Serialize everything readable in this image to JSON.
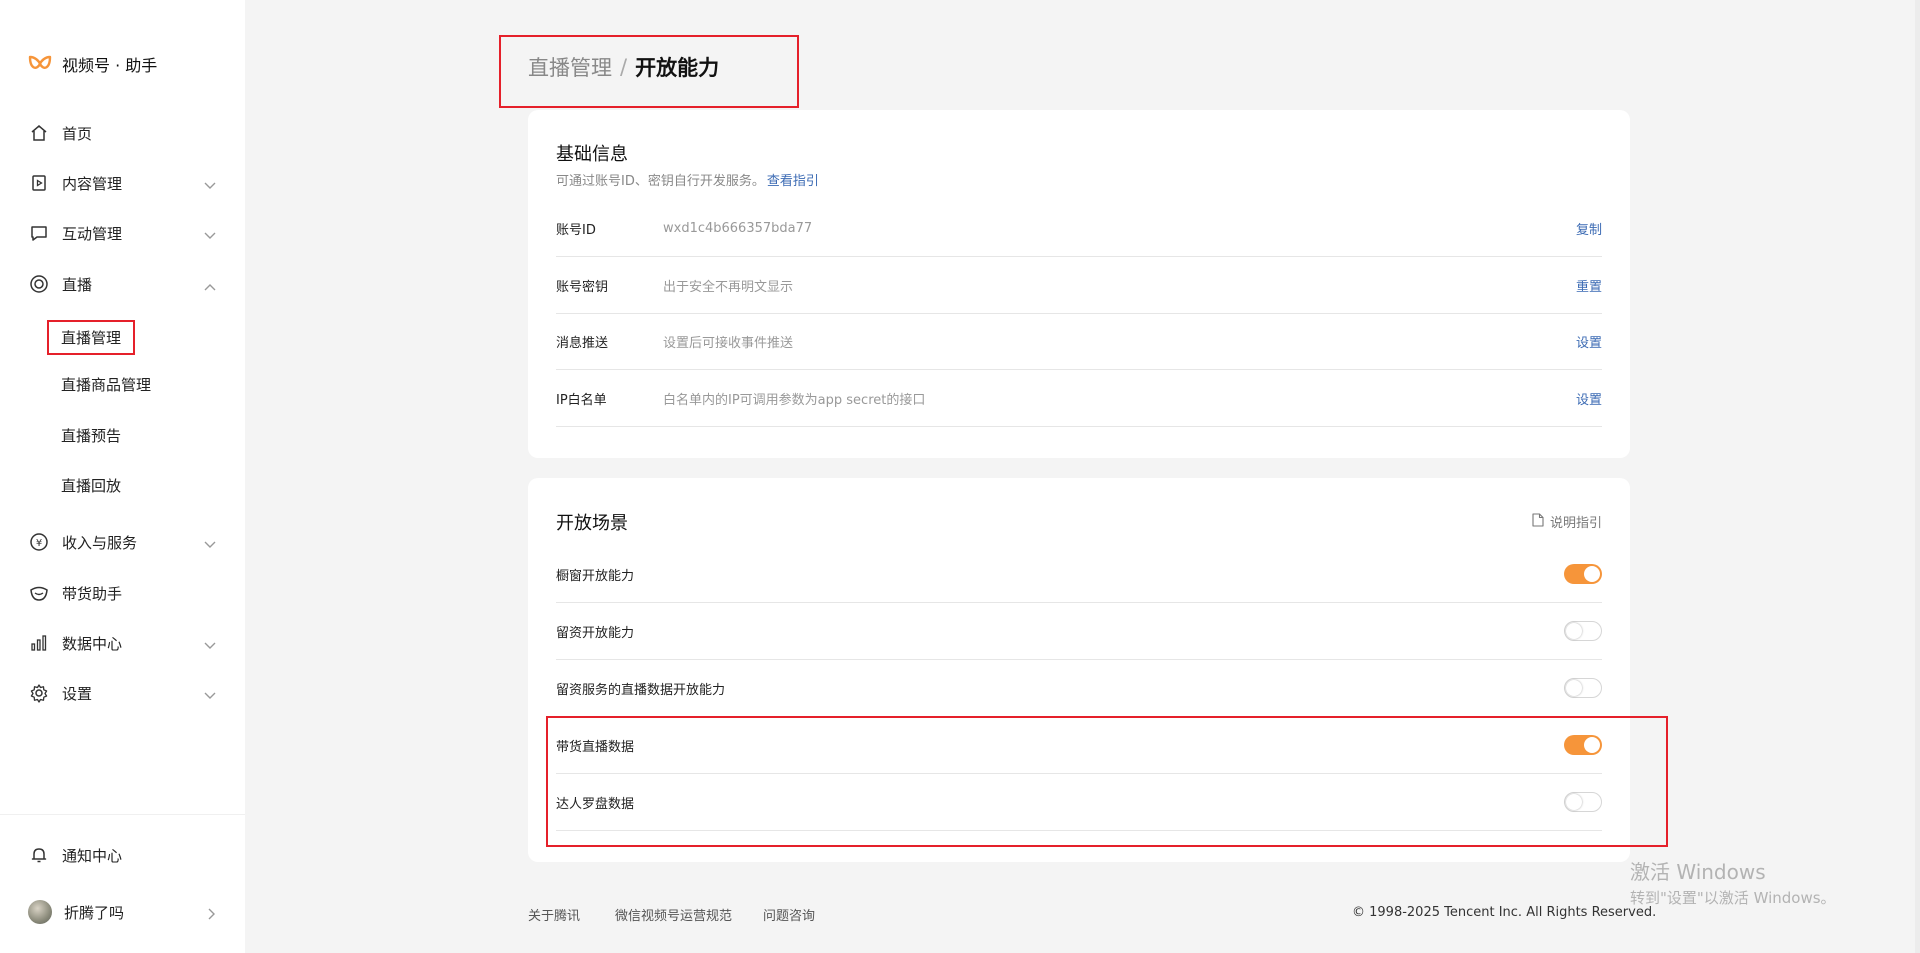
{
  "brand": {
    "name": "视频号 · 助手"
  },
  "sidebar": {
    "items": [
      {
        "label": "首页"
      },
      {
        "label": "内容管理"
      },
      {
        "label": "互动管理"
      },
      {
        "label": "直播"
      },
      {
        "label": "收入与服务"
      },
      {
        "label": "带货助手"
      },
      {
        "label": "数据中心"
      },
      {
        "label": "设置"
      }
    ],
    "live_sub_items": [
      {
        "label": "直播管理"
      },
      {
        "label": "直播商品管理"
      },
      {
        "label": "直播预告"
      },
      {
        "label": "直播回放"
      }
    ],
    "notification": "通知中心",
    "user_name": "折腾了吗"
  },
  "breadcrumb": {
    "parent": "直播管理",
    "separator": "/",
    "current": "开放能力"
  },
  "basic_info": {
    "title": "基础信息",
    "desc": "可通过账号ID、密钥自行开发服务。",
    "desc_link": "查看指引",
    "rows": [
      {
        "label": "账号ID",
        "value": "wxd1c4b666357bda77",
        "action": "复制"
      },
      {
        "label": "账号密钥",
        "value": "出于安全不再明文显示",
        "action": "重置"
      },
      {
        "label": "消息推送",
        "value": "设置后可接收事件推送",
        "action": "设置"
      },
      {
        "label": "IP白名单",
        "value": "白名单内的IP可调用参数为app secret的接口",
        "action": "设置"
      }
    ]
  },
  "open_scene": {
    "title": "开放场景",
    "guide": "说明指引",
    "rows": [
      {
        "label": "橱窗开放能力",
        "enabled": true
      },
      {
        "label": "留资开放能力",
        "enabled": false
      },
      {
        "label": "留资服务的直播数据开放能力",
        "enabled": false
      },
      {
        "label": "带货直播数据",
        "enabled": true
      },
      {
        "label": "达人罗盘数据",
        "enabled": false
      }
    ]
  },
  "footer": {
    "links": [
      "关于腾讯",
      "微信视频号运营规范",
      "问题咨询"
    ],
    "copyright": "© 1998-2025 Tencent Inc. All Rights Reserved."
  },
  "watermark": {
    "line1": "激活 Windows",
    "line2": "转到\"设置\"以激活 Windows。"
  },
  "colors": {
    "accent": "#f6953a",
    "link": "#3c6bb4",
    "annotation": "#e5202a"
  }
}
